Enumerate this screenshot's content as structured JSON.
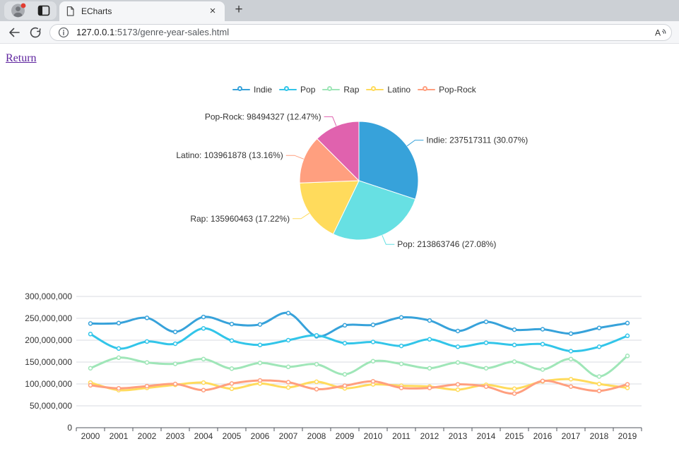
{
  "browser": {
    "tab_title": "ECharts",
    "url_host": "127.0.0.1",
    "url_rest": ":5173/genre-year-sales.html"
  },
  "icons": {
    "close": "×",
    "new_tab": "+"
  },
  "page": {
    "return_link": "Return"
  },
  "chart_data": [
    {
      "type": "pie",
      "legend": [
        "Indie",
        "Pop",
        "Rap",
        "Latino",
        "Pop-Rock"
      ],
      "legend_position": "top",
      "slices": [
        {
          "name": "Indie",
          "value": 237517311,
          "pct": 30.07,
          "color": "#37A2DA",
          "label": "Indie: 237517311 (30.07%)"
        },
        {
          "name": "Pop",
          "value": 213863746,
          "pct": 27.08,
          "color": "#67E0E3",
          "label": "Pop: 213863746 (27.08%)"
        },
        {
          "name": "Rap",
          "value": 135960463,
          "pct": 17.22,
          "color": "#FFDB5C",
          "label": "Rap: 135960463 (17.22%)"
        },
        {
          "name": "Latino",
          "value": 103961878,
          "pct": 13.16,
          "color": "#FF9F7F",
          "label": "Latino: 103961878 (13.16%)"
        },
        {
          "name": "Pop-Rock",
          "value": 98494327,
          "pct": 12.47,
          "color": "#E062AE",
          "label": "Pop-Rock: 98494327 (12.47%)"
        }
      ]
    },
    {
      "type": "line",
      "smooth": true,
      "grid": true,
      "x": [
        2000,
        2001,
        2002,
        2003,
        2004,
        2005,
        2006,
        2007,
        2008,
        2009,
        2010,
        2011,
        2012,
        2013,
        2014,
        2015,
        2016,
        2017,
        2018,
        2019
      ],
      "ylim": [
        0,
        300000000
      ],
      "yticks": [
        "0",
        "50,000,000",
        "100,000,000",
        "150,000,000",
        "200,000,000",
        "250,000,000",
        "300,000,000"
      ],
      "series": [
        {
          "name": "Indie",
          "color": "#37A2DA",
          "values": [
            238000000,
            239000000,
            251000000,
            219000000,
            253000000,
            237000000,
            236000000,
            262000000,
            209000000,
            234000000,
            235000000,
            252000000,
            245000000,
            221000000,
            242000000,
            224000000,
            225000000,
            215000000,
            228000000,
            239000000
          ]
        },
        {
          "name": "Pop",
          "color": "#32C5E9",
          "values": [
            214000000,
            181000000,
            197000000,
            192000000,
            227000000,
            199000000,
            189000000,
            200000000,
            211000000,
            193000000,
            196000000,
            187000000,
            202000000,
            185000000,
            194000000,
            189000000,
            191000000,
            175000000,
            185000000,
            210000000
          ]
        },
        {
          "name": "Rap",
          "color": "#9FE6B8",
          "values": [
            136000000,
            160000000,
            149000000,
            146000000,
            157000000,
            135000000,
            148000000,
            139000000,
            145000000,
            122000000,
            152000000,
            146000000,
            136000000,
            149000000,
            136000000,
            151000000,
            133000000,
            157000000,
            117000000,
            164000000
          ]
        },
        {
          "name": "Latino",
          "color": "#FFDB5C",
          "values": [
            103000000,
            86000000,
            91000000,
            98000000,
            103000000,
            89000000,
            101000000,
            92000000,
            105000000,
            90000000,
            99000000,
            96000000,
            94000000,
            87000000,
            98000000,
            89000000,
            106000000,
            111000000,
            100000000,
            91000000
          ]
        },
        {
          "name": "Pop-Rock",
          "color": "#FF9F7F",
          "values": [
            97000000,
            90000000,
            95000000,
            100000000,
            86000000,
            101000000,
            108000000,
            104000000,
            88000000,
            96000000,
            106000000,
            91000000,
            91000000,
            99000000,
            94000000,
            78000000,
            107000000,
            94000000,
            84000000,
            99000000
          ]
        }
      ]
    }
  ]
}
